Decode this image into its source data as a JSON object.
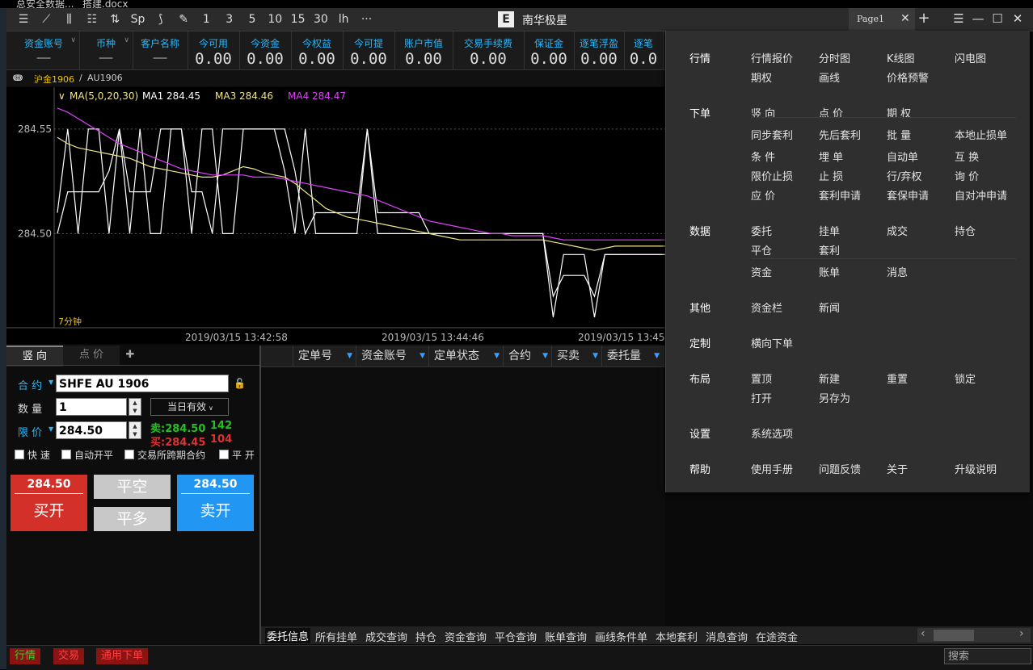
{
  "desktop": {
    "file1": "总安全数据...",
    "file2": "搭建.docx"
  },
  "titlebar": {
    "app_title": "南华极星",
    "logo": "E",
    "tools": [
      "list-icon",
      "line-chart-icon",
      "candlestick-icon",
      "bar-icon",
      "arrow-icon",
      "Sp",
      "s-icon",
      "pen-icon",
      "1",
      "3",
      "5",
      "10",
      "15",
      "30",
      "lh",
      "···"
    ],
    "page_tab": "Page1",
    "close_tab": "✕",
    "add_tab": "+",
    "menu_glyph": "☰",
    "minimize": "—",
    "maximize": "☐",
    "close": "✕"
  },
  "account": {
    "cells": [
      {
        "label": "资金账号",
        "value": "——",
        "dropdown": true
      },
      {
        "label": "币种",
        "value": "——",
        "dropdown": true
      },
      {
        "label": "客户名称",
        "value": "——"
      },
      {
        "label": "今可用",
        "value": "0.00"
      },
      {
        "label": "今资金",
        "value": "0.00"
      },
      {
        "label": "今权益",
        "value": "0.00"
      },
      {
        "label": "今可提",
        "value": "0.00"
      },
      {
        "label": "账户市值",
        "value": "0.00"
      },
      {
        "label": "交易手续费",
        "value": "0.00"
      },
      {
        "label": "保证金",
        "value": "0.00"
      },
      {
        "label": "逐笔浮盈",
        "value": "0.00"
      },
      {
        "label": "逐笔",
        "value": "0.0"
      }
    ]
  },
  "contract_path": {
    "icon": "ↈ",
    "name": "沪金1906",
    "sep": "/",
    "code": "AU1906"
  },
  "chart_data": {
    "type": "line",
    "legend": [
      {
        "text": "MA(5,0,20,30)",
        "color": "#f0e68c"
      },
      {
        "text": "MA1 284.45",
        "color": "#ffffff"
      },
      {
        "text": "MA3 284.46",
        "color": "#f0e68c"
      },
      {
        "text": "MA4 284.47",
        "color": "#e040fb"
      }
    ],
    "legend_chevron": "∨",
    "y_ticks": [
      "284.55",
      "284.50"
    ],
    "y_tick_values": [
      284.55,
      284.5
    ],
    "x_labels": [
      "2019/03/15 13:42:58",
      "2019/03/15 13:44:46",
      "2019/03/15 13:45:"
    ],
    "period_label": "7分钟",
    "ylim": [
      284.455,
      284.57
    ],
    "series": [
      {
        "color": "#ffffff",
        "values": [
          284.51,
          284.55,
          284.5,
          284.55,
          284.55,
          284.5,
          284.55,
          284.5,
          284.55,
          284.5,
          284.5,
          284.55,
          284.55,
          284.5,
          284.55,
          284.55,
          284.5,
          284.5,
          284.55,
          284.55,
          284.55,
          284.55,
          284.53,
          284.5,
          284.55,
          284.5,
          284.5,
          284.5,
          284.5,
          284.5,
          284.55,
          284.5,
          284.5,
          284.5,
          284.5,
          284.5,
          284.5,
          284.5,
          284.5,
          284.5,
          284.5,
          284.5,
          284.5,
          284.5,
          284.5,
          284.5,
          284.5,
          284.5,
          284.47,
          284.48,
          284.48,
          284.48,
          284.47,
          284.49,
          284.49,
          284.49,
          284.49,
          284.49,
          284.49,
          284.49
        ]
      },
      {
        "color": "#ffffff",
        "values": [
          284.5,
          284.52,
          284.52,
          284.52,
          284.52,
          284.53,
          284.55,
          284.52,
          284.52,
          284.52,
          284.55,
          284.55,
          284.55,
          284.52,
          284.52,
          284.5,
          284.55,
          284.55,
          284.55,
          284.55,
          284.55,
          284.55,
          284.55,
          284.53,
          284.5,
          284.51,
          284.51,
          284.51,
          284.51,
          284.51,
          284.55,
          284.51,
          284.51,
          284.51,
          284.51,
          284.51,
          284.5,
          284.5,
          284.5,
          284.5,
          284.5,
          284.5,
          284.5,
          284.5,
          284.5,
          284.5,
          284.5,
          284.5,
          284.46,
          284.49,
          284.49,
          284.49,
          284.46,
          284.49,
          284.49,
          284.49,
          284.49,
          284.49,
          284.49,
          284.49
        ]
      },
      {
        "color": "#f0e68c",
        "values": [
          284.546,
          284.543,
          284.541,
          284.54,
          284.539,
          284.538,
          284.537,
          284.536,
          284.534,
          284.532,
          284.531,
          284.53,
          284.529,
          284.528,
          284.527,
          284.527,
          284.528,
          284.53,
          284.532,
          284.531,
          284.529,
          284.528,
          284.527,
          284.524,
          284.52,
          284.516,
          284.512,
          284.51,
          284.508,
          284.507,
          284.506,
          284.505,
          284.504,
          284.503,
          284.502,
          284.501,
          284.5,
          284.499,
          284.498,
          284.497,
          284.497,
          284.497,
          284.497,
          284.497,
          284.497,
          284.497,
          284.497,
          284.497,
          284.496,
          284.495,
          284.494,
          284.493,
          284.492,
          284.493,
          284.494,
          284.494,
          284.494,
          284.494,
          284.494,
          284.494
        ]
      },
      {
        "color": "#e040fb",
        "values": [
          284.56,
          284.558,
          284.555,
          284.552,
          284.549,
          284.546,
          284.543,
          284.541,
          284.539,
          284.537,
          284.535,
          284.533,
          284.531,
          284.53,
          284.529,
          284.528,
          284.528,
          284.528,
          284.528,
          284.527,
          284.527,
          284.527,
          284.526,
          284.525,
          284.524,
          284.523,
          284.522,
          284.521,
          284.52,
          284.519,
          284.518,
          284.516,
          284.514,
          284.512,
          284.51,
          284.508,
          284.506,
          284.505,
          284.504,
          284.503,
          284.502,
          284.501,
          284.5,
          284.5,
          284.499,
          284.499,
          284.499,
          284.499,
          284.498,
          284.497,
          284.497,
          284.497,
          284.497,
          284.497,
          284.497,
          284.497,
          284.497,
          284.497,
          284.497,
          284.497
        ]
      }
    ]
  },
  "order": {
    "tabs": [
      "竖 向",
      "点 价"
    ],
    "add_tab": "✚",
    "contract_label": "合 约",
    "contract_value": "SHFE AU 1906",
    "lock_icon": "🔓",
    "qty_label": "数 量",
    "qty_value": "1",
    "validity": "当日有效",
    "price_label": "限 价",
    "price_value": "284.50",
    "ask_label": "卖:284.50",
    "ask_qty": "142",
    "bid_label": "买:284.45",
    "bid_qty": "104",
    "checks": [
      "快 速",
      "自动开平",
      "交易所跨期合约",
      "平 开"
    ],
    "buy": {
      "price": "284.50",
      "label": "买开",
      "color": "#d3302a"
    },
    "close_short": "平空",
    "close_long": "平多",
    "sell": {
      "price": "284.50",
      "label": "卖开",
      "color": "#2196f3"
    }
  },
  "grid": {
    "columns": [
      "定单号",
      "资金账号",
      "定单状态",
      "合约",
      "买卖",
      "委托量"
    ]
  },
  "bottom_tabs": [
    "委托信息",
    "所有挂单",
    "成交查询",
    "持仓",
    "资金查询",
    "平仓查询",
    "账单查询",
    "画线条件单",
    "本地套利",
    "消息查询",
    "在途资金"
  ],
  "scroll": {
    "left": "‹",
    "right": "›"
  },
  "status": {
    "buttons": [
      {
        "label": "行情",
        "color": "#22dd22"
      },
      {
        "label": "交易",
        "color": "#ff4040"
      },
      {
        "label": "通用下单",
        "color": "#ff4040"
      }
    ],
    "search_placeholder": "搜索"
  },
  "menu": {
    "sections": [
      {
        "title": "行情",
        "rows": [
          [
            "行情报价",
            "分时图",
            "K线图",
            "闪电图"
          ],
          [
            "期权",
            "画线",
            "价格预警"
          ]
        ]
      },
      {
        "title": "下单",
        "rows": [
          [
            "竖 向",
            "点 价",
            "期 权"
          ],
          [
            "同步套利",
            "先后套利",
            "批 量",
            "本地止损单"
          ],
          [
            "条 件",
            "埋 单",
            "自动单",
            "互 换"
          ],
          [
            "限价止损",
            "止 损",
            "行/弃权",
            "询 价"
          ],
          [
            "应 价",
            "套利申请",
            "套保申请",
            "自对冲申请"
          ]
        ]
      },
      {
        "title": "数据",
        "rows": [
          [
            "委托",
            "挂单",
            "成交",
            "持仓"
          ],
          [
            "平仓",
            "套利"
          ],
          [
            "资金",
            "账单",
            "消息"
          ]
        ]
      },
      {
        "title": "其他",
        "rows": [
          [
            "资金栏",
            "新闻"
          ]
        ]
      },
      {
        "title": "定制",
        "rows": [
          [
            "横向下单"
          ]
        ]
      },
      {
        "title": "布局",
        "rows": [
          [
            "置顶",
            "新建",
            "重置",
            "锁定"
          ],
          [
            "打开",
            "另存为"
          ]
        ]
      },
      {
        "title": "设置",
        "rows": [
          [
            "系统选项"
          ]
        ]
      },
      {
        "title": "帮助",
        "rows": [
          [
            "使用手册",
            "问题反馈",
            "关于",
            "升级说明"
          ]
        ]
      }
    ]
  }
}
